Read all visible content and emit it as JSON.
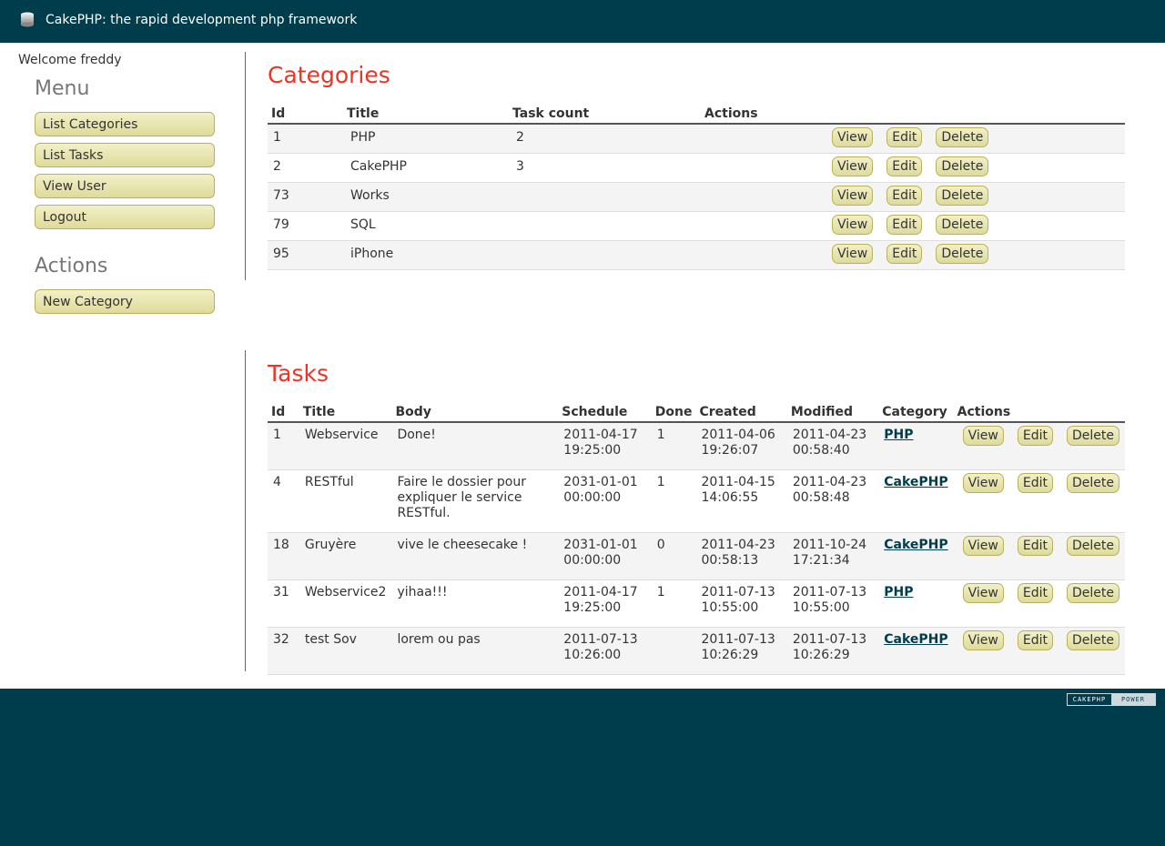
{
  "header": {
    "title": "CakePHP: the rapid development php framework",
    "logo_icon": "cake-icon"
  },
  "sidebar": {
    "welcome": "Welcome freddy",
    "menu_heading": "Menu",
    "menu_items": [
      "List Categories",
      "List Tasks",
      "View User",
      "Logout"
    ],
    "actions_heading": "Actions",
    "action_items": [
      "New Category"
    ]
  },
  "categories": {
    "title": "Categories",
    "columns": [
      "Id",
      "Title",
      "Task count",
      "Actions"
    ],
    "rows": [
      {
        "id": "1",
        "title": "PHP",
        "count": "2"
      },
      {
        "id": "2",
        "title": "CakePHP",
        "count": "3"
      },
      {
        "id": "73",
        "title": "Works",
        "count": ""
      },
      {
        "id": "79",
        "title": "SQL",
        "count": ""
      },
      {
        "id": "95",
        "title": "iPhone",
        "count": ""
      }
    ]
  },
  "tasks": {
    "title": "Tasks",
    "columns": [
      "Id",
      "Title",
      "Body",
      "Schedule",
      "Done",
      "Created",
      "Modified",
      "Category",
      "Actions"
    ],
    "rows": [
      {
        "id": "1",
        "title": "Webservice",
        "body": "Done!",
        "schedule": "2011-04-17 19:25:00",
        "done": "1",
        "created": "2011-04-06 19:26:07",
        "modified": "2011-04-23 00:58:40",
        "category": "PHP"
      },
      {
        "id": "4",
        "title": "RESTful",
        "body": "Faire le dossier pour expliquer le service RESTful.",
        "schedule": "2031-01-01 00:00:00",
        "done": "1",
        "created": "2011-04-15 14:06:55",
        "modified": "2011-04-23 00:58:48",
        "category": "CakePHP"
      },
      {
        "id": "18",
        "title": "Gruyère",
        "body": "vive le cheesecake !",
        "schedule": "2031-01-01 00:00:00",
        "done": "0",
        "created": "2011-04-23 00:58:13",
        "modified": "2011-10-24 17:21:34",
        "category": "CakePHP"
      },
      {
        "id": "31",
        "title": "Webservice2",
        "body": "yihaa!!!",
        "schedule": "2011-04-17 19:25:00",
        "done": "1",
        "created": "2011-07-13 10:55:00",
        "modified": "2011-07-13 10:55:00",
        "category": "PHP"
      },
      {
        "id": "32",
        "title": "test Sov",
        "body": "lorem ou pas",
        "schedule": "2011-07-13 10:26:00",
        "done": "",
        "created": "2011-07-13 10:26:29",
        "modified": "2011-07-13 10:26:29",
        "category": "CakePHP"
      }
    ]
  },
  "action_labels": {
    "view": "View",
    "edit": "Edit",
    "delete": "Delete"
  },
  "footer": {
    "powered_left": "CAKEPHP",
    "powered_right": "POWER"
  },
  "colors": {
    "brand": "#003d4c",
    "heading": "#e32",
    "button": "#e8e5b0"
  }
}
